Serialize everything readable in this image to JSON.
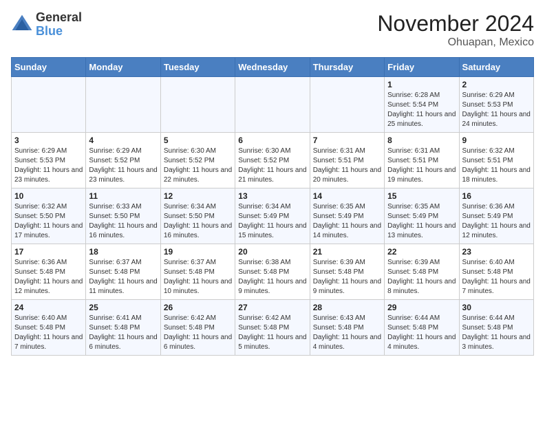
{
  "logo": {
    "general": "General",
    "blue": "Blue"
  },
  "title": "November 2024",
  "subtitle": "Ohuapan, Mexico",
  "weekdays": [
    "Sunday",
    "Monday",
    "Tuesday",
    "Wednesday",
    "Thursday",
    "Friday",
    "Saturday"
  ],
  "weeks": [
    [
      {
        "day": "",
        "info": ""
      },
      {
        "day": "",
        "info": ""
      },
      {
        "day": "",
        "info": ""
      },
      {
        "day": "",
        "info": ""
      },
      {
        "day": "",
        "info": ""
      },
      {
        "day": "1",
        "info": "Sunrise: 6:28 AM\nSunset: 5:54 PM\nDaylight: 11 hours and 25 minutes."
      },
      {
        "day": "2",
        "info": "Sunrise: 6:29 AM\nSunset: 5:53 PM\nDaylight: 11 hours and 24 minutes."
      }
    ],
    [
      {
        "day": "3",
        "info": "Sunrise: 6:29 AM\nSunset: 5:53 PM\nDaylight: 11 hours and 23 minutes."
      },
      {
        "day": "4",
        "info": "Sunrise: 6:29 AM\nSunset: 5:52 PM\nDaylight: 11 hours and 23 minutes."
      },
      {
        "day": "5",
        "info": "Sunrise: 6:30 AM\nSunset: 5:52 PM\nDaylight: 11 hours and 22 minutes."
      },
      {
        "day": "6",
        "info": "Sunrise: 6:30 AM\nSunset: 5:52 PM\nDaylight: 11 hours and 21 minutes."
      },
      {
        "day": "7",
        "info": "Sunrise: 6:31 AM\nSunset: 5:51 PM\nDaylight: 11 hours and 20 minutes."
      },
      {
        "day": "8",
        "info": "Sunrise: 6:31 AM\nSunset: 5:51 PM\nDaylight: 11 hours and 19 minutes."
      },
      {
        "day": "9",
        "info": "Sunrise: 6:32 AM\nSunset: 5:51 PM\nDaylight: 11 hours and 18 minutes."
      }
    ],
    [
      {
        "day": "10",
        "info": "Sunrise: 6:32 AM\nSunset: 5:50 PM\nDaylight: 11 hours and 17 minutes."
      },
      {
        "day": "11",
        "info": "Sunrise: 6:33 AM\nSunset: 5:50 PM\nDaylight: 11 hours and 16 minutes."
      },
      {
        "day": "12",
        "info": "Sunrise: 6:34 AM\nSunset: 5:50 PM\nDaylight: 11 hours and 16 minutes."
      },
      {
        "day": "13",
        "info": "Sunrise: 6:34 AM\nSunset: 5:49 PM\nDaylight: 11 hours and 15 minutes."
      },
      {
        "day": "14",
        "info": "Sunrise: 6:35 AM\nSunset: 5:49 PM\nDaylight: 11 hours and 14 minutes."
      },
      {
        "day": "15",
        "info": "Sunrise: 6:35 AM\nSunset: 5:49 PM\nDaylight: 11 hours and 13 minutes."
      },
      {
        "day": "16",
        "info": "Sunrise: 6:36 AM\nSunset: 5:49 PM\nDaylight: 11 hours and 12 minutes."
      }
    ],
    [
      {
        "day": "17",
        "info": "Sunrise: 6:36 AM\nSunset: 5:48 PM\nDaylight: 11 hours and 12 minutes."
      },
      {
        "day": "18",
        "info": "Sunrise: 6:37 AM\nSunset: 5:48 PM\nDaylight: 11 hours and 11 minutes."
      },
      {
        "day": "19",
        "info": "Sunrise: 6:37 AM\nSunset: 5:48 PM\nDaylight: 11 hours and 10 minutes."
      },
      {
        "day": "20",
        "info": "Sunrise: 6:38 AM\nSunset: 5:48 PM\nDaylight: 11 hours and 9 minutes."
      },
      {
        "day": "21",
        "info": "Sunrise: 6:39 AM\nSunset: 5:48 PM\nDaylight: 11 hours and 9 minutes."
      },
      {
        "day": "22",
        "info": "Sunrise: 6:39 AM\nSunset: 5:48 PM\nDaylight: 11 hours and 8 minutes."
      },
      {
        "day": "23",
        "info": "Sunrise: 6:40 AM\nSunset: 5:48 PM\nDaylight: 11 hours and 7 minutes."
      }
    ],
    [
      {
        "day": "24",
        "info": "Sunrise: 6:40 AM\nSunset: 5:48 PM\nDaylight: 11 hours and 7 minutes."
      },
      {
        "day": "25",
        "info": "Sunrise: 6:41 AM\nSunset: 5:48 PM\nDaylight: 11 hours and 6 minutes."
      },
      {
        "day": "26",
        "info": "Sunrise: 6:42 AM\nSunset: 5:48 PM\nDaylight: 11 hours and 6 minutes."
      },
      {
        "day": "27",
        "info": "Sunrise: 6:42 AM\nSunset: 5:48 PM\nDaylight: 11 hours and 5 minutes."
      },
      {
        "day": "28",
        "info": "Sunrise: 6:43 AM\nSunset: 5:48 PM\nDaylight: 11 hours and 4 minutes."
      },
      {
        "day": "29",
        "info": "Sunrise: 6:44 AM\nSunset: 5:48 PM\nDaylight: 11 hours and 4 minutes."
      },
      {
        "day": "30",
        "info": "Sunrise: 6:44 AM\nSunset: 5:48 PM\nDaylight: 11 hours and 3 minutes."
      }
    ]
  ]
}
